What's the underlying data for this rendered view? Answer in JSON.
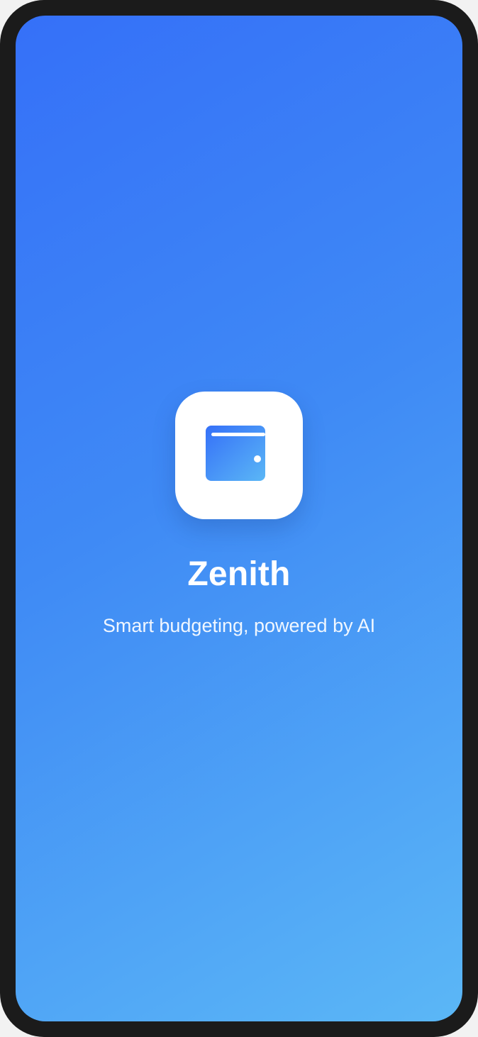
{
  "app": {
    "name": "Zenith",
    "tagline": "Smart budgeting, powered by AI",
    "icon": "wallet-icon"
  },
  "colors": {
    "gradient_start": "#3570f8",
    "gradient_end": "#5bb7f6",
    "frame": "#1b1b1b",
    "icon_tile": "#ffffff"
  }
}
